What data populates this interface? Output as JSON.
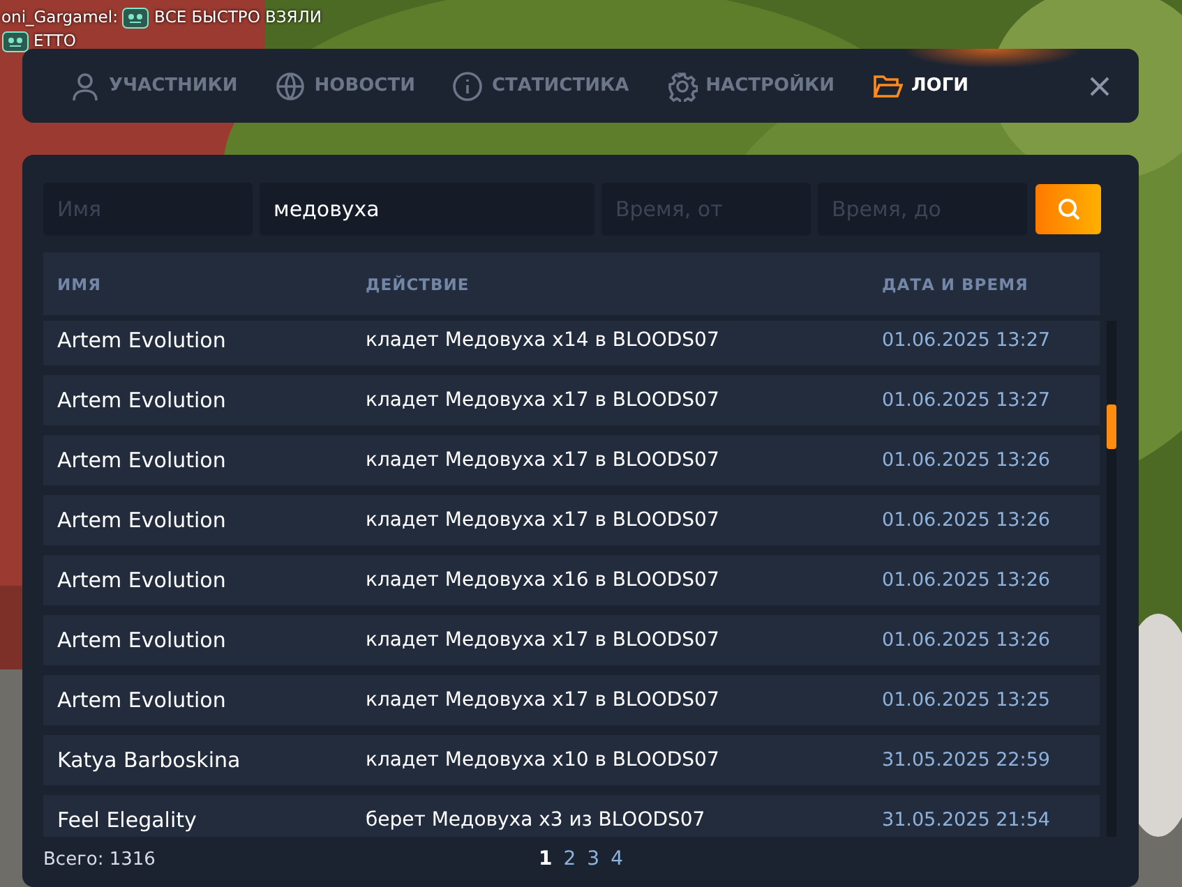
{
  "chat": [
    {
      "author": "oni_Gargamel:",
      "text": "ВСЕ БЫСТРО ВЗЯЛИ"
    },
    {
      "text": "ЕТТО"
    }
  ],
  "tabs": [
    {
      "label": "УЧАСТНИКИ",
      "selected": false
    },
    {
      "label": "НОВОСТИ",
      "selected": false
    },
    {
      "label": "СТАТИСТИКА",
      "selected": false
    },
    {
      "label": "НАСТРОЙКИ",
      "selected": false
    },
    {
      "label": "ЛОГИ",
      "selected": true
    }
  ],
  "filters": [
    {
      "placeholder": "Имя"
    },
    {
      "value": "медовуха"
    },
    {
      "placeholder": "Время, от"
    },
    {
      "placeholder": "Время, до"
    }
  ],
  "table": {
    "columns": [
      "ИМЯ",
      "ДЕЙСТВИЕ",
      "ДАТА И ВРЕМЯ"
    ],
    "rows": [
      [
        "Artem Evolution",
        "кладет Медовуха x14 в BLOODS07",
        "01.06.2025 13:27"
      ],
      [
        "Artem Evolution",
        "кладет Медовуха x17 в BLOODS07",
        "01.06.2025 13:27"
      ],
      [
        "Artem Evolution",
        "кладет Медовуха x17 в BLOODS07",
        "01.06.2025 13:26"
      ],
      [
        "Artem Evolution",
        "кладет Медовуха x17 в BLOODS07",
        "01.06.2025 13:26"
      ],
      [
        "Artem Evolution",
        "кладет Медовуха x16 в BLOODS07",
        "01.06.2025 13:26"
      ],
      [
        "Artem Evolution",
        "кладет Медовуха x17 в BLOODS07",
        "01.06.2025 13:26"
      ],
      [
        "Artem Evolution",
        "кладет Медовуха x17 в BLOODS07",
        "01.06.2025 13:25"
      ],
      [
        "Katya Barboskina",
        "кладет Медовуха x10 в BLOODS07",
        "31.05.2025 22:59"
      ],
      [
        "Feel Elegality",
        "берет Медовуха x3 из BLOODS07",
        "31.05.2025 21:54"
      ]
    ]
  },
  "total": "Всего: 1316",
  "pages": [
    {
      "label": "1",
      "selected": true
    },
    {
      "label": "2",
      "selected": false
    },
    {
      "label": "3",
      "selected": false
    },
    {
      "label": "4",
      "selected": false
    }
  ]
}
